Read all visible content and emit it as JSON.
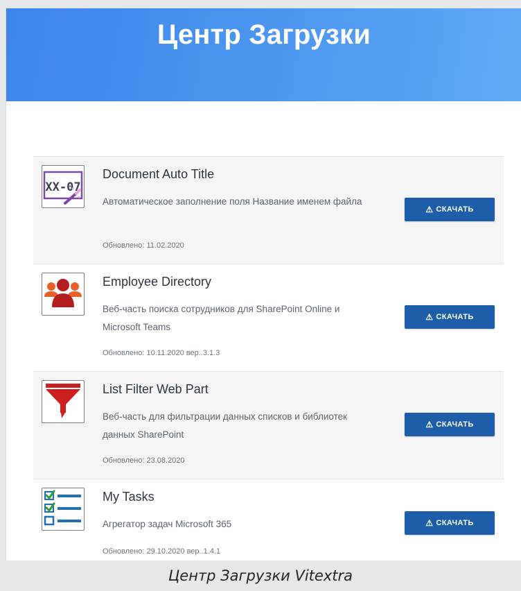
{
  "header": {
    "title": "Центр Загрузки"
  },
  "items": [
    {
      "title": "Document Auto Title",
      "description": "Автоматическое заполнение поля Название именем файла",
      "updated": "Обновлено: 11.02.2020",
      "icon": "document-auto-title-icon",
      "download_label": "СКАЧАТЬ"
    },
    {
      "title": "Employee Directory",
      "description": "Веб-часть поиска сотрудников для SharePoint Online и Microsoft Teams",
      "updated": "Обновлено: 10.11.2020 вер..3.1.3",
      "icon": "employee-directory-icon",
      "download_label": "СКАЧАТЬ"
    },
    {
      "title": "List Filter Web Part",
      "description": "Веб-часть для фильтрации данных списков и библиотек данных SharePoint",
      "updated": "Обновлено: 23.08.2020",
      "icon": "funnel-filter-icon",
      "download_label": "СКАЧАТЬ"
    },
    {
      "title": "My Tasks",
      "description": "Агрегатор задач Microsoft 365",
      "updated": "Обновлено: 29.10.2020 вер..1.4.1",
      "icon": "task-checklist-icon",
      "download_label": "СКАЧАТЬ"
    }
  ],
  "caption": "Центр Загрузки Vitextra",
  "colors": {
    "hero_gradient_start": "#3f86ea",
    "hero_gradient_end": "#60aaf5",
    "button": "#1e5ea8",
    "card_bg": "#f5f5f5",
    "card_alt_bg": "#ffffff",
    "icon_purple": "#7a4aa5",
    "icon_red": "#cc1f1f",
    "icon_orange": "#e8602a",
    "icon_green": "#2e9b3c",
    "icon_blue": "#1d6fb8"
  }
}
